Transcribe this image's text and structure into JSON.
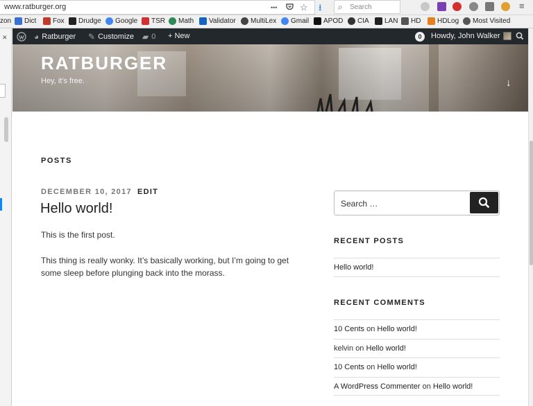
{
  "browser": {
    "url": "www.ratburger.org",
    "search_placeholder": "Search",
    "overflow_glyph": "•••",
    "bookmarks": [
      {
        "label": "zon",
        "color": "#ffffff"
      },
      {
        "label": "Dict",
        "color": "#3b6fd4"
      },
      {
        "label": "Fox",
        "color": "#c0392b"
      },
      {
        "label": "Drudge",
        "color": "#222222"
      },
      {
        "label": "Google",
        "color": "#4285f4"
      },
      {
        "label": "TSR",
        "color": "#d32f2f"
      },
      {
        "label": "Math",
        "color": "#2e8b57"
      },
      {
        "label": "Validator",
        "color": "#1565c0"
      },
      {
        "label": "MultiLex",
        "color": "#444444"
      },
      {
        "label": "Gmail",
        "color": "#4285f4"
      },
      {
        "label": "APOD",
        "color": "#111111"
      },
      {
        "label": "CIA",
        "color": "#333333"
      },
      {
        "label": "LAN",
        "color": "#222222"
      },
      {
        "label": "HD",
        "color": "#555555"
      },
      {
        "label": "HDLog",
        "color": "#e67e22"
      },
      {
        "label": "Most Visited",
        "color": "#555555"
      }
    ]
  },
  "adminbar": {
    "site": "Ratburger",
    "customize": "Customize",
    "comments_count": "0",
    "new": "+ New",
    "updates_count": "0",
    "howdy": "Howdy, John Walker"
  },
  "site": {
    "title": "RATBURGER",
    "tagline": "Hey, it's free."
  },
  "main": {
    "heading": "POSTS",
    "post": {
      "date": "DECEMBER 10, 2017",
      "edit": "EDIT",
      "title": "Hello world!",
      "paragraph1": "This is the first post.",
      "paragraph2": "This thing is really wonky.  It’s basically working, but I’m going to get some sleep before plunging back into the morass."
    }
  },
  "sidebar": {
    "search_placeholder": "Search …",
    "recent_posts_title": "RECENT POSTS",
    "recent_posts": [
      "Hello world!"
    ],
    "recent_comments_title": "RECENT COMMENTS",
    "recent_comments": [
      {
        "author": "10 Cents",
        "on": "on",
        "post": "Hello world!"
      },
      {
        "author": "kelvin",
        "on": "on",
        "post": "Hello world!"
      },
      {
        "author": "10 Cents",
        "on": "on",
        "post": "Hello world!"
      },
      {
        "author": "A WordPress Commenter",
        "on": "on",
        "post": "Hello world!"
      }
    ]
  }
}
